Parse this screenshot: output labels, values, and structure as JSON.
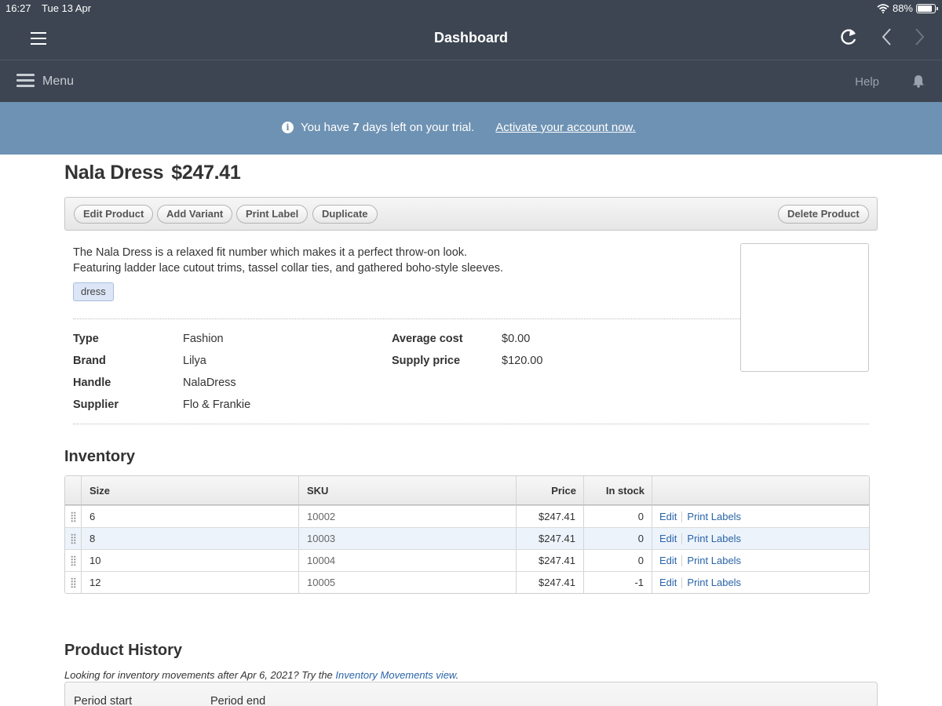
{
  "status": {
    "time": "16:27",
    "date": "Tue 13 Apr",
    "battery": "88%",
    "battery_level": 0.88
  },
  "nav": {
    "title": "Dashboard"
  },
  "menubar": {
    "menu_label": "Menu",
    "help": "Help"
  },
  "trial": {
    "text_before": "You have",
    "days": "7",
    "text_after": "days left on your trial.",
    "link": "Activate your account now."
  },
  "product": {
    "name": "Nala Dress",
    "price": "$247.41",
    "description_line1": "The Nala Dress is a relaxed fit number which makes it a perfect throw-on look.",
    "description_line2": "Featuring ladder lace cutout trims, tassel collar ties, and gathered boho-style sleeves.",
    "tag": "dress"
  },
  "toolbar": {
    "edit": "Edit Product",
    "add_variant": "Add Variant",
    "print_label": "Print Label",
    "duplicate": "Duplicate",
    "delete": "Delete Product"
  },
  "attributes": {
    "left": [
      {
        "label": "Type",
        "value": "Fashion"
      },
      {
        "label": "Brand",
        "value": "Lilya"
      },
      {
        "label": "Handle",
        "value": "NalaDress"
      },
      {
        "label": "Supplier",
        "value": "Flo & Frankie"
      }
    ],
    "right": [
      {
        "label": "Average cost",
        "value": "$0.00"
      },
      {
        "label": "Supply price",
        "value": "$120.00"
      }
    ]
  },
  "inventory": {
    "title": "Inventory",
    "headers": {
      "size": "Size",
      "sku": "SKU",
      "price": "Price",
      "stock": "In stock"
    },
    "rows": [
      {
        "size": "6",
        "sku": "10002",
        "price": "$247.41",
        "stock": "0",
        "edit": "Edit",
        "print": "Print Labels"
      },
      {
        "size": "8",
        "sku": "10003",
        "price": "$247.41",
        "stock": "0",
        "edit": "Edit",
        "print": "Print Labels"
      },
      {
        "size": "10",
        "sku": "10004",
        "price": "$247.41",
        "stock": "0",
        "edit": "Edit",
        "print": "Print Labels"
      },
      {
        "size": "12",
        "sku": "10005",
        "price": "$247.41",
        "stock": "-1",
        "edit": "Edit",
        "print": "Print Labels"
      }
    ]
  },
  "history": {
    "title": "Product History",
    "note_before": "Looking for inventory movements after Apr 6, 2021? Try the",
    "note_link": "Inventory Movements view",
    "note_after": ".",
    "col_period_start": "Period start",
    "col_period_end": "Period end"
  },
  "colors": {
    "nav_bg": "#3c4551",
    "banner_bg": "#6e92b3",
    "link": "#2a64a8"
  }
}
